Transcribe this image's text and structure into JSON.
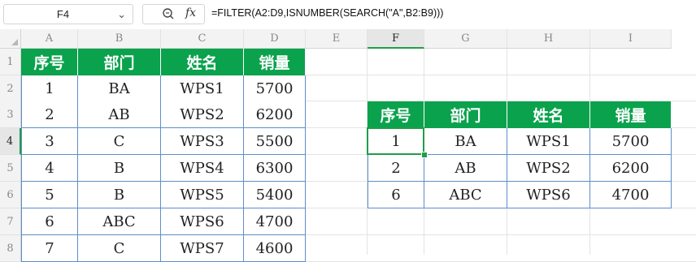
{
  "formula_bar": {
    "name_box": "F4",
    "name_box_chevron": "chevron-down-icon",
    "zoom_icon": "zoom-icon",
    "fx_label": "fx",
    "formula": "=FILTER(A2:D9,ISNUMBER(SEARCH(\"A\",B2:B9)))"
  },
  "columns": [
    "A",
    "B",
    "C",
    "D",
    "E",
    "F",
    "G",
    "H",
    "I"
  ],
  "rows": [
    "1",
    "2",
    "3",
    "4",
    "5",
    "6",
    "7",
    "8"
  ],
  "active": {
    "column": "F",
    "row": "4"
  },
  "colors": {
    "header_fill": "#0ba24d",
    "selection": "#1e9e4a",
    "table_border": "#5b8fc9"
  },
  "source_table": {
    "headers": [
      "序号",
      "部门",
      "姓名",
      "销量"
    ],
    "rows": [
      [
        "1",
        "BA",
        "WPS1",
        "5700"
      ],
      [
        "2",
        "AB",
        "WPS2",
        "6200"
      ],
      [
        "3",
        "C",
        "WPS3",
        "5500"
      ],
      [
        "4",
        "B",
        "WPS4",
        "6300"
      ],
      [
        "5",
        "B",
        "WPS5",
        "5400"
      ],
      [
        "6",
        "ABC",
        "WPS6",
        "4700"
      ],
      [
        "7",
        "C",
        "WPS7",
        "4600"
      ]
    ]
  },
  "result_table": {
    "headers": [
      "序号",
      "部门",
      "姓名",
      "销量"
    ],
    "rows": [
      [
        "1",
        "BA",
        "WPS1",
        "5700"
      ],
      [
        "2",
        "AB",
        "WPS2",
        "6200"
      ],
      [
        "6",
        "ABC",
        "WPS6",
        "4700"
      ]
    ]
  }
}
